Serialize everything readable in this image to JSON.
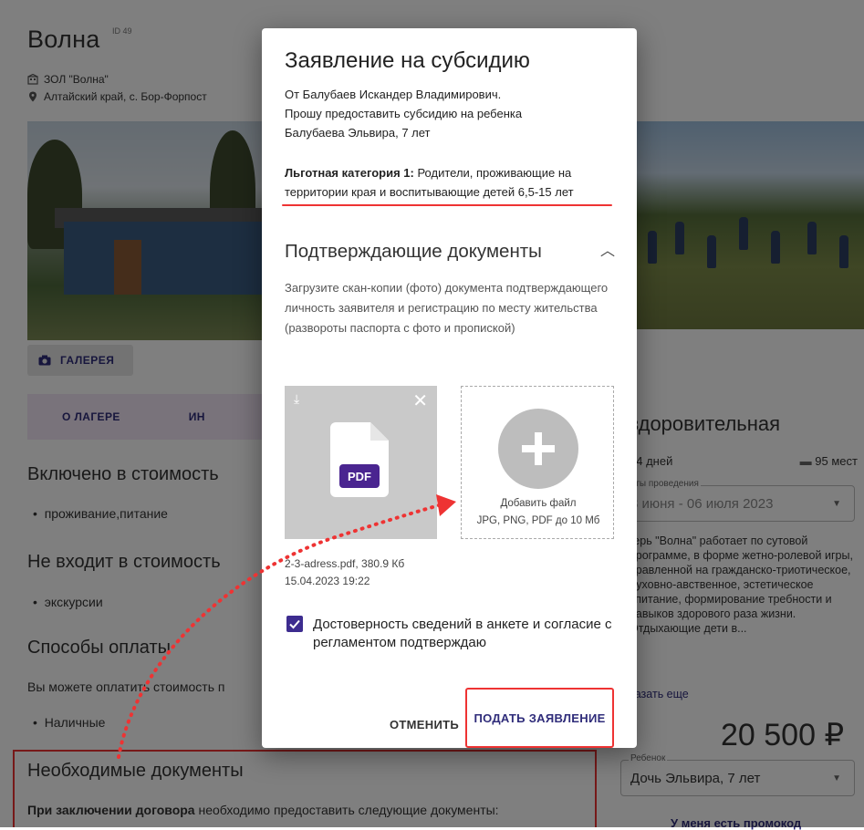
{
  "camp": {
    "title": "Волна",
    "id_label": "ID 49",
    "org": "ЗОЛ \"Волна\"",
    "location": "Алтайский край, с. Бор-Форпост"
  },
  "left": {
    "gallery_label": "ГАЛЕРЕЯ",
    "tab_about": "О ЛАГЕРЕ",
    "tab_info": "ИН",
    "included_title": "Включено в стоимость",
    "included_items": [
      "проживание,питание"
    ],
    "not_included_title": "Не входит в стоимость",
    "not_included_items": [
      "экскурсии"
    ],
    "payment_title": "Способы оплаты",
    "payment_text": "Вы можете оплатить стоимость п",
    "payment_items": [
      "Наличные"
    ],
    "docs_title": "Необходимые документы",
    "docs_text_bold": "При заключении договора",
    "docs_text": " необходимо предоставить следующие документы:"
  },
  "right": {
    "shift_title": "здоровительная",
    "duration": "14 дней",
    "places": "95 мест",
    "dates_label": "аты проведения",
    "dates_value": "3 июня - 06 июля 2023",
    "description": "герь \"Волна\" работает по сутовой программе, в форме жетно-ролевой игры, правленной на гражданско-триотическое, духовно-авственное, эстетическое спитание, формирование требности и навыков здорового раза жизни. Отдыхающие дети в...",
    "more_link": "казать еще",
    "price": "20 500 ₽",
    "child_label": "Ребенок",
    "child_value": "Дочь Эльвира, 7 лет",
    "promo": "У меня есть промокод"
  },
  "modal": {
    "title": "Заявление на субсидию",
    "applicant_line1": "От Балубаев Искандер Владимирович.",
    "applicant_line2": "Прошу предоставить субсидию на ребенка",
    "applicant_line3": "Балубаева Эльвира, 7 лет",
    "category_label": "Льготная категория 1:",
    "category_text": " Родители, проживающие на территории края и воспитывающие детей 6,5-15 лет",
    "docs_section": "Подтверждающие документы",
    "docs_help": "Загрузите скан-копии (фото) документа подтверждающего личность заявителя и регистрацию по месту жительства (развороты паспорта с фото и пропиской)",
    "file_badge": "PDF",
    "file_name": "2-3-adress.pdf, 380.9 Кб",
    "file_date": "15.04.2023 19:22",
    "add_file": "Добавить файл",
    "add_formats": "JPG, PNG, PDF до 10 Мб",
    "consent": "Достоверность сведений в анкете и согласие с регламентом подтверждаю",
    "cancel": "ОТМЕНИТЬ",
    "submit": "ПОДАТЬ ЗАЯВЛЕНИЕ"
  },
  "colors": {
    "primary": "#2f2c7a",
    "checkbox": "#3d2c8f",
    "pdf_badge": "#4a2590",
    "highlight": "#e33333"
  }
}
